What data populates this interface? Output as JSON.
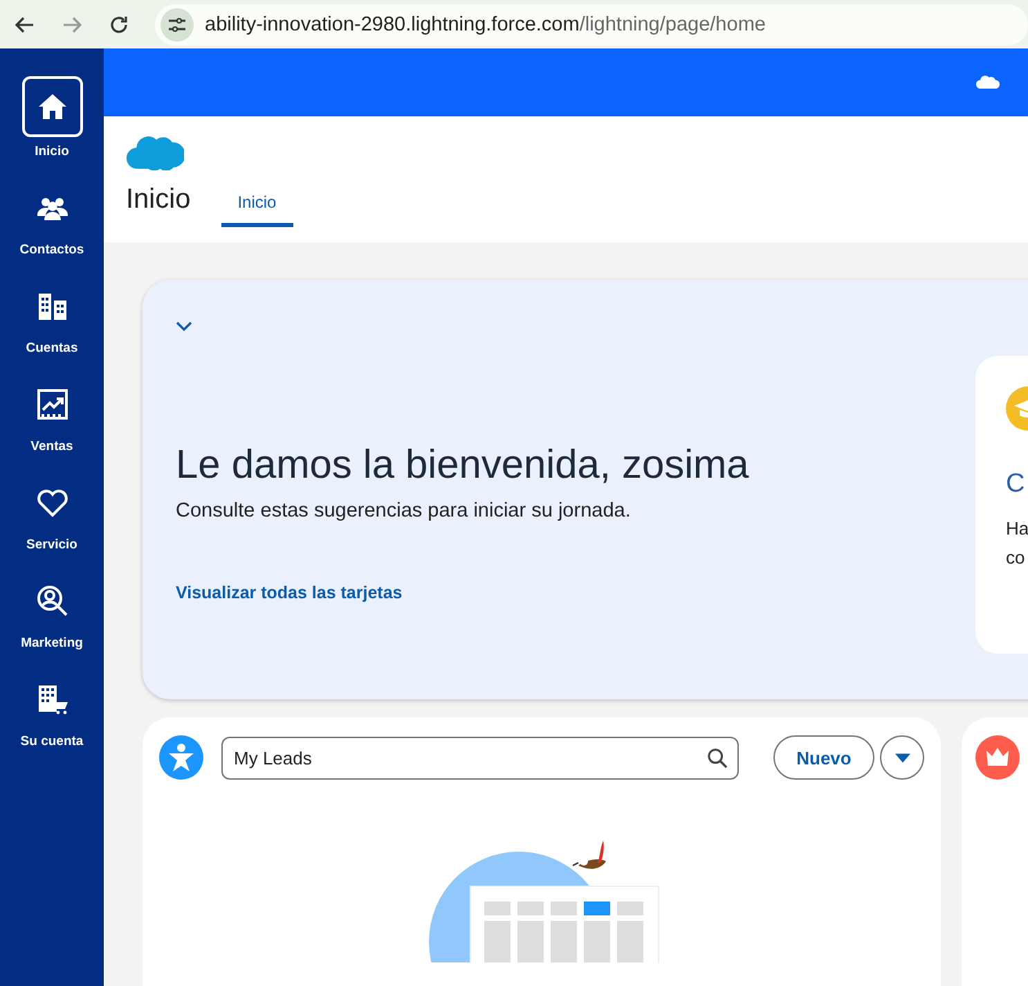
{
  "browser": {
    "url_host": "ability-innovation-2980.lightning.force.com",
    "url_path": "/lightning/page/home"
  },
  "sidebar": {
    "items": [
      {
        "label": "Inicio",
        "kind": "home",
        "selected": true
      },
      {
        "label": "Contactos",
        "kind": "contacts",
        "selected": false
      },
      {
        "label": "Cuentas",
        "kind": "accounts",
        "selected": false
      },
      {
        "label": "Ventas",
        "kind": "sales",
        "selected": false
      },
      {
        "label": "Servicio",
        "kind": "service",
        "selected": false
      },
      {
        "label": "Marketing",
        "kind": "marketing",
        "selected": false
      },
      {
        "label": "Su cuenta",
        "kind": "your-account",
        "selected": false
      }
    ]
  },
  "page_header": {
    "title": "Inicio",
    "tabs": [
      {
        "label": "Inicio",
        "selected": true
      }
    ]
  },
  "welcome": {
    "heading": "Le damos la bienvenida, zosima",
    "subtitle": "Consulte estas sugerencias para iniciar su jornada.",
    "link": "Visualizar todas las tarjetas",
    "suggestion_card": {
      "title": "C",
      "text_lines": [
        "Ha",
        "co"
      ]
    }
  },
  "list_card": {
    "search": {
      "value": "My Leads"
    },
    "new_button": "Nuevo"
  }
}
